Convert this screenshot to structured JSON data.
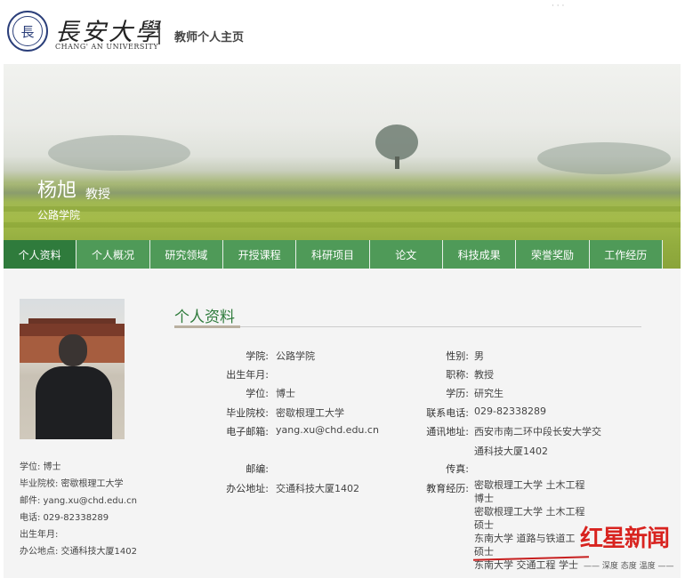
{
  "header": {
    "logo_cn": "長安大學",
    "logo_en": "CHANG' AN UNIVERSITY",
    "logo_mark": "長",
    "title": "教师个人主页",
    "top_links": "·   ·  ·"
  },
  "profile": {
    "name": "杨旭",
    "title": "教授",
    "college": "公路学院"
  },
  "nav": {
    "items": [
      "个人资料",
      "个人概况",
      "研究领域",
      "开授课程",
      "科研项目",
      "论文",
      "科技成果",
      "荣誉奖励",
      "工作经历"
    ],
    "active": "个人资料"
  },
  "left_info": {
    "degree": "学位:  博士",
    "school": "毕业院校:  密歇根理工大学",
    "email": "邮件:  yang.xu@chd.edu.cn",
    "phone": "电话:  029-82338289",
    "birth": "出生年月:",
    "office": "办公地点:  交通科技大厦1402"
  },
  "section": {
    "title": "个人资料"
  },
  "fields": {
    "college_label": "学院:",
    "college_value": "公路学院",
    "gender_label": "性别:",
    "gender_value": "男",
    "birth_label": "出生年月:",
    "birth_value": "",
    "rank_label": "职称:",
    "rank_value": "教授",
    "degree_label": "学位:",
    "degree_value": "博士",
    "edu_label": "学历:",
    "edu_value": "研究生",
    "school_label": "毕业院校:",
    "school_value": "密歇根理工大学",
    "phone_label": "联系电话:",
    "phone_value": "029-82338289",
    "email_label": "电子邮箱:",
    "email_value": "yang.xu@chd.edu.cn",
    "address_label": "通讯地址:",
    "address_value_1": "西安市南二环中段长安大学交",
    "address_value_2": "通科技大厦1402",
    "zip_label": "邮编:",
    "zip_value": "",
    "fax_label": "传真:",
    "fax_value": "",
    "office_label": "办公地址:",
    "office_value": "交通科技大厦1402",
    "eduexp_label": "教育经历:"
  },
  "education": [
    "密歇根理工大学 土木工程",
    "博士",
    "密歇根理工大学 土木工程",
    "硕士",
    "东南大学 道路与铁道工",
    "硕士",
    "东南大学 交通工程 学士"
  ],
  "watermark": {
    "main": "红星新闻",
    "sub": "—— 深度 态度 温度 ——"
  },
  "colors": {
    "nav_green": "#4f9a58",
    "nav_active": "#2f7b3c",
    "title_green": "#2f7b3c",
    "watermark_red": "#d8231f"
  }
}
